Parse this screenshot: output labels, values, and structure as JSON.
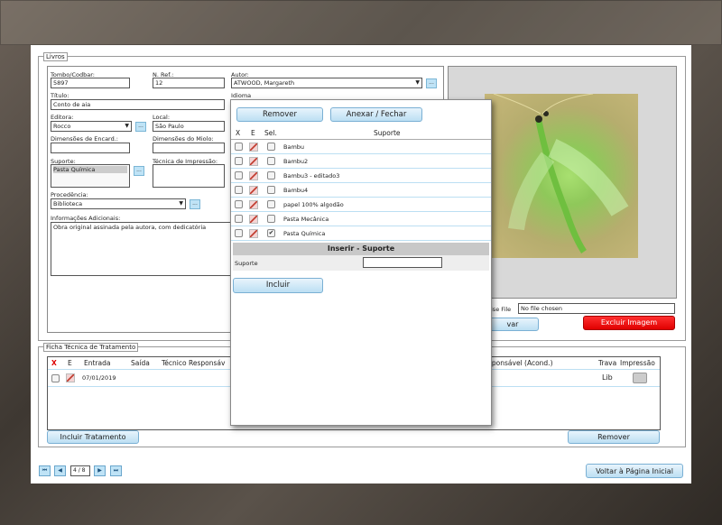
{
  "book_section": {
    "legend": "Livros",
    "tombo_label": "Tombo/Codbar:",
    "tombo_value": "5897",
    "nref_label": "N. Ref.:",
    "nref_value": "12",
    "autor_label": "Autor:",
    "autor_value": "ATWOOD, Margareth",
    "titulo_label": "Título:",
    "titulo_value": "Conto de aia",
    "idioma_label": "Idioma",
    "editora_label": "Editora:",
    "editora_value": "Rocco",
    "local_label": "Local:",
    "local_value": "São Paulo",
    "dim_encard_label": "Dimensões de Encard.:",
    "dim_miolo_label": "Dimensões do Miolo:",
    "suporte_label": "Suporte:",
    "suporte_value": "Pasta Química",
    "tecnica_label": "Técnica de Impressão:",
    "procedencia_label": "Procedência:",
    "procedencia_value": "Biblioteca",
    "info_label": "Informações Adicionais:",
    "info_value": "Obra original assinada pela autora, com dedicatória",
    "dots": "...",
    "file_label": "ise File",
    "file_value": "No file chosen",
    "salvar_partial": "var",
    "excluir_imagem": "Excluir Imagem"
  },
  "treatment_section": {
    "legend": "Ficha Técnica de Tratamento",
    "headers": [
      "X",
      "E",
      "Entrada",
      "Saída",
      "Técnico Responsáv",
      "sponsável (Acond.)",
      "Trava",
      "Impressão"
    ],
    "row": {
      "entrada": "07/01/2019",
      "trava": "Lib"
    },
    "incluir_button": "Incluir Tratamento",
    "remover_button": "Remover"
  },
  "pagination": {
    "page": "4 / 8",
    "first": "⏮",
    "prev": "◀",
    "next": "▶",
    "last": "⏭"
  },
  "voltar_button": "Voltar à Página Inicial",
  "modal": {
    "remover_button": "Remover",
    "anexar_button": "Anexar / Fechar",
    "headers": [
      "X",
      "E",
      "Sel.",
      "Suporte"
    ],
    "rows": [
      {
        "name": "Bambu",
        "selected": false
      },
      {
        "name": "Bambu2",
        "selected": false
      },
      {
        "name": "Bambu3 - editado3",
        "selected": false
      },
      {
        "name": "Bambu4",
        "selected": false
      },
      {
        "name": "papel 100% algodão",
        "selected": false
      },
      {
        "name": "Pasta Mecânica",
        "selected": false
      },
      {
        "name": "Pasta Química",
        "selected": true
      }
    ],
    "insert_title": "Inserir - Suporte",
    "insert_label": "Suporte",
    "incluir_button": "Incluir"
  },
  "colors": {
    "accent": "#bcdff3",
    "danger": "#e00000"
  }
}
